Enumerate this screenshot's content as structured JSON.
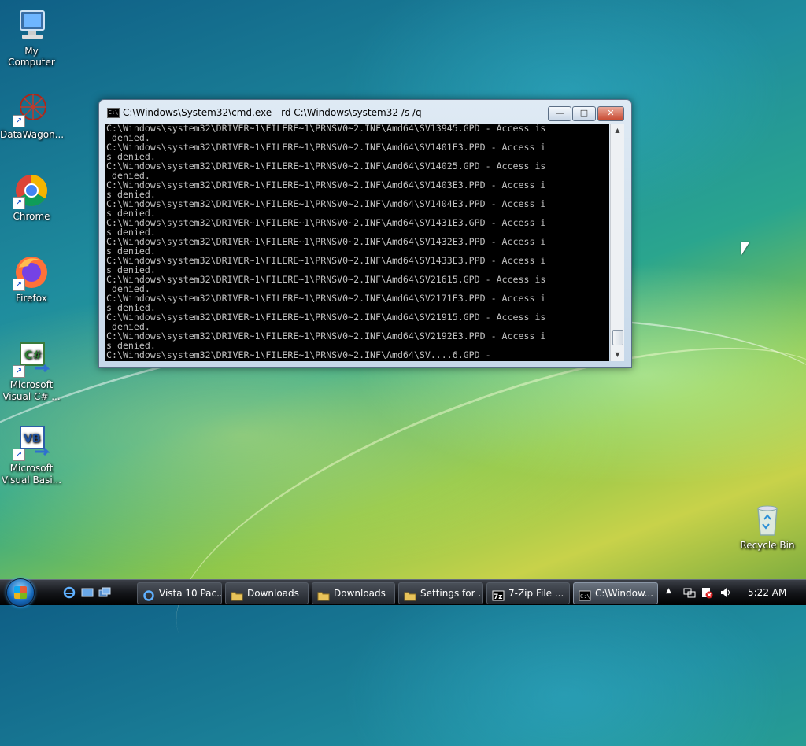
{
  "desktop": {
    "icons": [
      {
        "label": "My Computer",
        "icon": "computer-icon"
      },
      {
        "label": "DataWagon...",
        "icon": "datawagon-icon"
      },
      {
        "label": "Chrome",
        "icon": "chrome-icon"
      },
      {
        "label": "Firefox",
        "icon": "firefox-icon"
      },
      {
        "label": "Microsoft Visual C# ...",
        "icon": "visual-csharp-icon"
      },
      {
        "label": "Microsoft Visual Basi...",
        "icon": "visual-basic-icon"
      },
      {
        "label": "Recycle Bin",
        "icon": "recycle-bin-icon"
      }
    ]
  },
  "window": {
    "title": "C:\\Windows\\System32\\cmd.exe - rd  C:\\Windows\\system32 /s /q",
    "buttons": {
      "minimize": "—",
      "maximize": "□",
      "close": "✕"
    },
    "console_text": "C:\\Windows\\system32\\DRIVER~1\\FILERE~1\\PRNSV0~2.INF\\Amd64\\SV13945.GPD - Access is\n denied.\nC:\\Windows\\system32\\DRIVER~1\\FILERE~1\\PRNSV0~2.INF\\Amd64\\SV1401E3.PPD - Access i\ns denied.\nC:\\Windows\\system32\\DRIVER~1\\FILERE~1\\PRNSV0~2.INF\\Amd64\\SV14025.GPD - Access is\n denied.\nC:\\Windows\\system32\\DRIVER~1\\FILERE~1\\PRNSV0~2.INF\\Amd64\\SV1403E3.PPD - Access i\ns denied.\nC:\\Windows\\system32\\DRIVER~1\\FILERE~1\\PRNSV0~2.INF\\Amd64\\SV1404E3.PPD - Access i\ns denied.\nC:\\Windows\\system32\\DRIVER~1\\FILERE~1\\PRNSV0~2.INF\\Amd64\\SV1431E3.GPD - Access i\ns denied.\nC:\\Windows\\system32\\DRIVER~1\\FILERE~1\\PRNSV0~2.INF\\Amd64\\SV1432E3.PPD - Access i\ns denied.\nC:\\Windows\\system32\\DRIVER~1\\FILERE~1\\PRNSV0~2.INF\\Amd64\\SV1433E3.PPD - Access i\ns denied.\nC:\\Windows\\system32\\DRIVER~1\\FILERE~1\\PRNSV0~2.INF\\Amd64\\SV21615.GPD - Access is\n denied.\nC:\\Windows\\system32\\DRIVER~1\\FILERE~1\\PRNSV0~2.INF\\Amd64\\SV2171E3.PPD - Access i\ns denied.\nC:\\Windows\\system32\\DRIVER~1\\FILERE~1\\PRNSV0~2.INF\\Amd64\\SV21915.GPD - Access is\n denied.\nC:\\Windows\\system32\\DRIVER~1\\FILERE~1\\PRNSV0~2.INF\\Amd64\\SV2192E3.PPD - Access i\ns denied.\nC:\\Windows\\system32\\DRIVER~1\\FILERE~1\\PRNSV0~2.INF\\Amd64\\SV....6.GPD -"
  },
  "taskbar": {
    "quick_launch": [
      "ie-icon",
      "show-desktop-icon",
      "switch-windows-icon"
    ],
    "buttons": [
      {
        "label": "Vista 10 Pac...",
        "icon": "ie-icon"
      },
      {
        "label": "Downloads",
        "icon": "folder-icon"
      },
      {
        "label": "Downloads",
        "icon": "folder-icon"
      },
      {
        "label": "Settings for ...",
        "icon": "settings-icon"
      },
      {
        "label": "7-Zip File ...",
        "icon": "7zip-icon"
      },
      {
        "label": "C:\\Window...",
        "icon": "cmd-icon"
      }
    ],
    "tray": {
      "chevron": "▲",
      "clock": "5:22 AM"
    }
  },
  "colors": {
    "console_bg": "#000000",
    "console_fg": "#c0c0c0",
    "taskbar": "#14161a"
  }
}
